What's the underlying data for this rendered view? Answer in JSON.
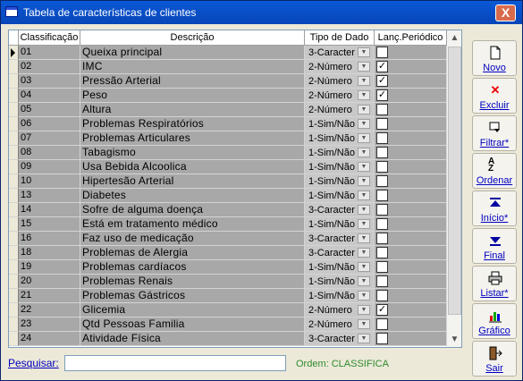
{
  "window": {
    "title": "Tabela de características de clientes",
    "close_label": "X"
  },
  "grid": {
    "headers": {
      "classificacao": "Classificação",
      "descricao": "Descrição",
      "tipo": "Tipo de Dado",
      "lanc": "Lanç.Periódico"
    },
    "rows": [
      {
        "cls": "01",
        "desc": "Queixa principal",
        "type": "3-Caracter",
        "checked": false
      },
      {
        "cls": "02",
        "desc": "IMC",
        "type": "2-Número",
        "checked": true
      },
      {
        "cls": "03",
        "desc": "Pressão Arterial",
        "type": "2-Número",
        "checked": true
      },
      {
        "cls": "04",
        "desc": "Peso",
        "type": "2-Número",
        "checked": true
      },
      {
        "cls": "05",
        "desc": "Altura",
        "type": "2-Número",
        "checked": false
      },
      {
        "cls": "06",
        "desc": "Problemas Respiratórios",
        "type": "1-Sim/Não",
        "checked": false
      },
      {
        "cls": "07",
        "desc": "Problemas Articulares",
        "type": "1-Sim/Não",
        "checked": false
      },
      {
        "cls": "08",
        "desc": "Tabagismo",
        "type": "1-Sim/Não",
        "checked": false
      },
      {
        "cls": "09",
        "desc": "Usa Bebida Alcoolica",
        "type": "1-Sim/Não",
        "checked": false
      },
      {
        "cls": "10",
        "desc": "Hipertesão Arterial",
        "type": "1-Sim/Não",
        "checked": false
      },
      {
        "cls": "13",
        "desc": "Diabetes",
        "type": "1-Sim/Não",
        "checked": false
      },
      {
        "cls": "14",
        "desc": "Sofre de alguma doença",
        "type": "3-Caracter",
        "checked": false
      },
      {
        "cls": "15",
        "desc": "Está em tratamento médico",
        "type": "1-Sim/Não",
        "checked": false
      },
      {
        "cls": "16",
        "desc": "Faz uso de medicação",
        "type": "3-Caracter",
        "checked": false
      },
      {
        "cls": "18",
        "desc": "Problemas de Alergia",
        "type": "3-Caracter",
        "checked": false
      },
      {
        "cls": "19",
        "desc": "Problemas cardíacos",
        "type": "1-Sim/Não",
        "checked": false
      },
      {
        "cls": "20",
        "desc": "Problemas Renais",
        "type": "1-Sim/Não",
        "checked": false
      },
      {
        "cls": "21",
        "desc": "Problemas Gástricos",
        "type": "1-Sim/Não",
        "checked": false
      },
      {
        "cls": "22",
        "desc": "Glicemia",
        "type": "2-Número",
        "checked": true
      },
      {
        "cls": "23",
        "desc": "Qtd Pessoas Familia",
        "type": "2-Número",
        "checked": false
      },
      {
        "cls": "24",
        "desc": "Atividade Física",
        "type": "3-Caracter",
        "checked": false
      }
    ]
  },
  "toolbar": {
    "novo": "Novo",
    "novo_icon": "new-document-icon",
    "excluir": "Excluir",
    "excluir_icon": "delete-x-icon",
    "filtrar": "Filtrar*",
    "filtrar_icon": "filter-icon",
    "ordenar": "Ordenar",
    "ordenar_icon": "sort-az-icon",
    "inicio": "Início*",
    "inicio_icon": "first-record-icon",
    "final": "Final",
    "final_icon": "last-record-icon",
    "listar": "Listar*",
    "listar_icon": "printer-icon",
    "grafico": "Gráfico",
    "grafico_icon": "chart-icon",
    "sair": "Sair",
    "sair_icon": "exit-door-icon"
  },
  "search": {
    "label": "Pesquisar:",
    "value": ""
  },
  "order": {
    "text": "Ordem: CLASSIFICA"
  },
  "colors": {
    "title_bar": "#0846b8",
    "row_bg": "#a8a8a8",
    "order_text": "#2e8b2e",
    "link_blue": "#0000c0"
  }
}
